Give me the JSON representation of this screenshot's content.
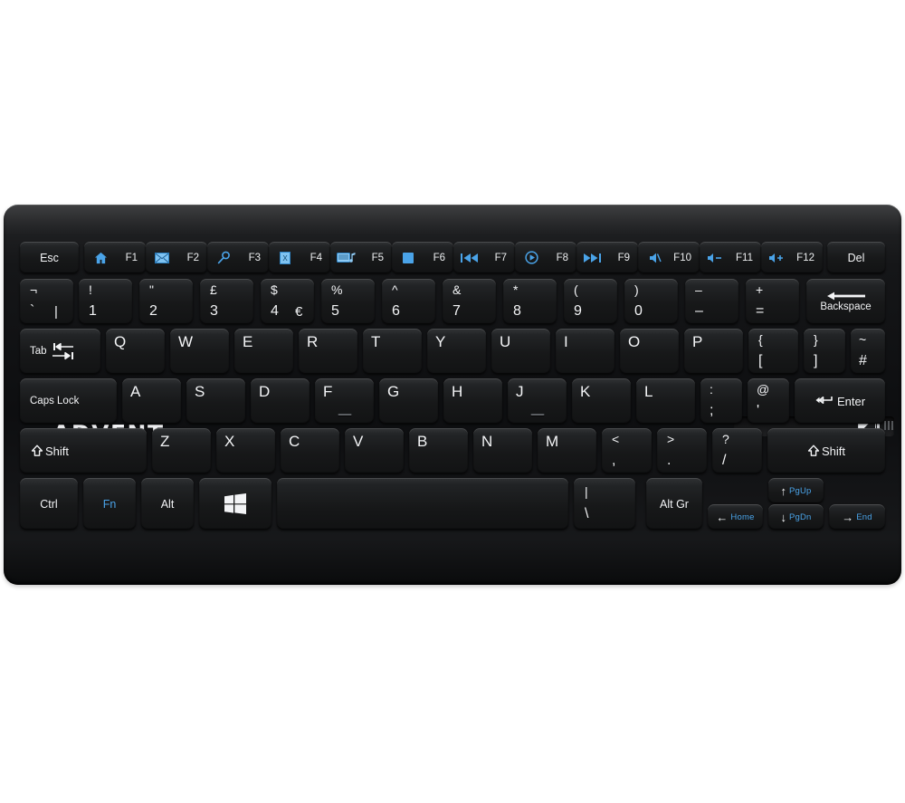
{
  "product": {
    "brand": "ADVENT",
    "type": "wireless-keyboard",
    "layout": "UK QWERTY",
    "body_color": "#121314",
    "accent_color": "#4aa3e8",
    "key_text_color": "#f3f4f6",
    "battery_indicator": "battery-icon"
  },
  "rows": {
    "function_row": [
      {
        "name": "esc",
        "label": "Esc",
        "icon": null,
        "fn": null
      },
      {
        "name": "f1",
        "label": null,
        "icon": "home-icon",
        "fn": "F1"
      },
      {
        "name": "f2",
        "label": null,
        "icon": "envelope-icon",
        "fn": "F2"
      },
      {
        "name": "f3",
        "label": null,
        "icon": "search-icon",
        "fn": "F3"
      },
      {
        "name": "f4",
        "label": null,
        "icon": "excel-icon",
        "fn": "F4"
      },
      {
        "name": "f5",
        "label": null,
        "icon": "media-player-icon",
        "fn": "F5"
      },
      {
        "name": "f6",
        "label": null,
        "icon": "stop-icon",
        "fn": "F6"
      },
      {
        "name": "f7",
        "label": null,
        "icon": "previous-track-icon",
        "fn": "F7"
      },
      {
        "name": "f8",
        "label": null,
        "icon": "play-pause-icon",
        "fn": "F8"
      },
      {
        "name": "f9",
        "label": null,
        "icon": "next-track-icon",
        "fn": "F9"
      },
      {
        "name": "f10",
        "label": null,
        "icon": "mute-icon",
        "fn": "F10"
      },
      {
        "name": "f11",
        "label": null,
        "icon": "volume-down-icon",
        "fn": "F11"
      },
      {
        "name": "f12",
        "label": null,
        "icon": "volume-up-icon",
        "fn": "F12"
      },
      {
        "name": "del",
        "label": "Del",
        "icon": null,
        "fn": null
      }
    ],
    "number_row": [
      {
        "name": "backtick",
        "top": "¬",
        "bottom": "`",
        "extra": "|"
      },
      {
        "name": "1",
        "top": "!",
        "bottom": "1",
        "extra": null
      },
      {
        "name": "2",
        "top": "\"",
        "bottom": "2",
        "extra": null
      },
      {
        "name": "3",
        "top": "£",
        "bottom": "3",
        "extra": null
      },
      {
        "name": "4",
        "top": "$",
        "bottom": "4",
        "extra": "€"
      },
      {
        "name": "5",
        "top": "%",
        "bottom": "5",
        "extra": null
      },
      {
        "name": "6",
        "top": "^",
        "bottom": "6",
        "extra": null
      },
      {
        "name": "7",
        "top": "&",
        "bottom": "7",
        "extra": null
      },
      {
        "name": "8",
        "top": "*",
        "bottom": "8",
        "extra": null
      },
      {
        "name": "9",
        "top": "(",
        "bottom": "9",
        "extra": null
      },
      {
        "name": "0",
        "top": ")",
        "bottom": "0",
        "extra": null
      },
      {
        "name": "minus",
        "top": "–",
        "bottom": "–",
        "extra": null
      },
      {
        "name": "equals",
        "top": "+",
        "bottom": "=",
        "extra": null
      },
      {
        "name": "backspace",
        "label": "Backspace",
        "icon": "left-arrow-icon"
      }
    ],
    "top_row": [
      {
        "name": "tab",
        "label": "Tab",
        "icon": "tab-arrows-icon"
      },
      {
        "name": "q",
        "label": "Q"
      },
      {
        "name": "w",
        "label": "W"
      },
      {
        "name": "e",
        "label": "E"
      },
      {
        "name": "r",
        "label": "R"
      },
      {
        "name": "t",
        "label": "T"
      },
      {
        "name": "y",
        "label": "Y"
      },
      {
        "name": "u",
        "label": "U"
      },
      {
        "name": "i",
        "label": "I"
      },
      {
        "name": "o",
        "label": "O"
      },
      {
        "name": "p",
        "label": "P"
      },
      {
        "name": "bracket-left",
        "top": "{",
        "bottom": "["
      },
      {
        "name": "bracket-right",
        "top": "}",
        "bottom": "]"
      },
      {
        "name": "hash",
        "top": "~",
        "bottom": "#"
      }
    ],
    "home_row": [
      {
        "name": "caps-lock",
        "label": "Caps Lock"
      },
      {
        "name": "a",
        "label": "A"
      },
      {
        "name": "s",
        "label": "S"
      },
      {
        "name": "d",
        "label": "D"
      },
      {
        "name": "f",
        "label": "F",
        "homing": true
      },
      {
        "name": "g",
        "label": "G"
      },
      {
        "name": "h",
        "label": "H"
      },
      {
        "name": "j",
        "label": "J",
        "homing": true
      },
      {
        "name": "k",
        "label": "K"
      },
      {
        "name": "l",
        "label": "L"
      },
      {
        "name": "semicolon",
        "top": ":",
        "bottom": ";"
      },
      {
        "name": "apostrophe",
        "top": "@",
        "bottom": "'"
      },
      {
        "name": "enter",
        "label": "Enter",
        "icon": "enter-arrow-icon"
      }
    ],
    "shift_row": [
      {
        "name": "shift-left",
        "label": "Shift",
        "icon": "shift-arrow-icon"
      },
      {
        "name": "z",
        "label": "Z"
      },
      {
        "name": "x",
        "label": "X"
      },
      {
        "name": "c",
        "label": "C"
      },
      {
        "name": "v",
        "label": "V"
      },
      {
        "name": "b",
        "label": "B"
      },
      {
        "name": "n",
        "label": "N"
      },
      {
        "name": "m",
        "label": "M"
      },
      {
        "name": "comma",
        "top": "<",
        "bottom": ","
      },
      {
        "name": "period",
        "top": ">",
        "bottom": "."
      },
      {
        "name": "slash",
        "top": "?",
        "bottom": "/"
      },
      {
        "name": "shift-right",
        "label": "Shift",
        "icon": "shift-arrow-icon"
      }
    ],
    "bottom_row": [
      {
        "name": "ctrl",
        "label": "Ctrl",
        "color": "white"
      },
      {
        "name": "fn",
        "label": "Fn",
        "color": "blue"
      },
      {
        "name": "alt",
        "label": "Alt",
        "color": "white"
      },
      {
        "name": "windows",
        "label": null,
        "icon": "windows-icon"
      },
      {
        "name": "space",
        "label": null
      },
      {
        "name": "backslash",
        "top": "|",
        "bottom": "\\"
      },
      {
        "name": "alt-gr",
        "label": "Alt Gr",
        "color": "white"
      },
      {
        "name": "arrow-left",
        "glyph": "←",
        "word": "Home"
      },
      {
        "name": "arrow-up",
        "glyph": "↑",
        "word": "PgUp"
      },
      {
        "name": "arrow-down",
        "glyph": "↓",
        "word": "PgDn"
      },
      {
        "name": "arrow-right",
        "glyph": "→",
        "word": "End"
      }
    ]
  }
}
